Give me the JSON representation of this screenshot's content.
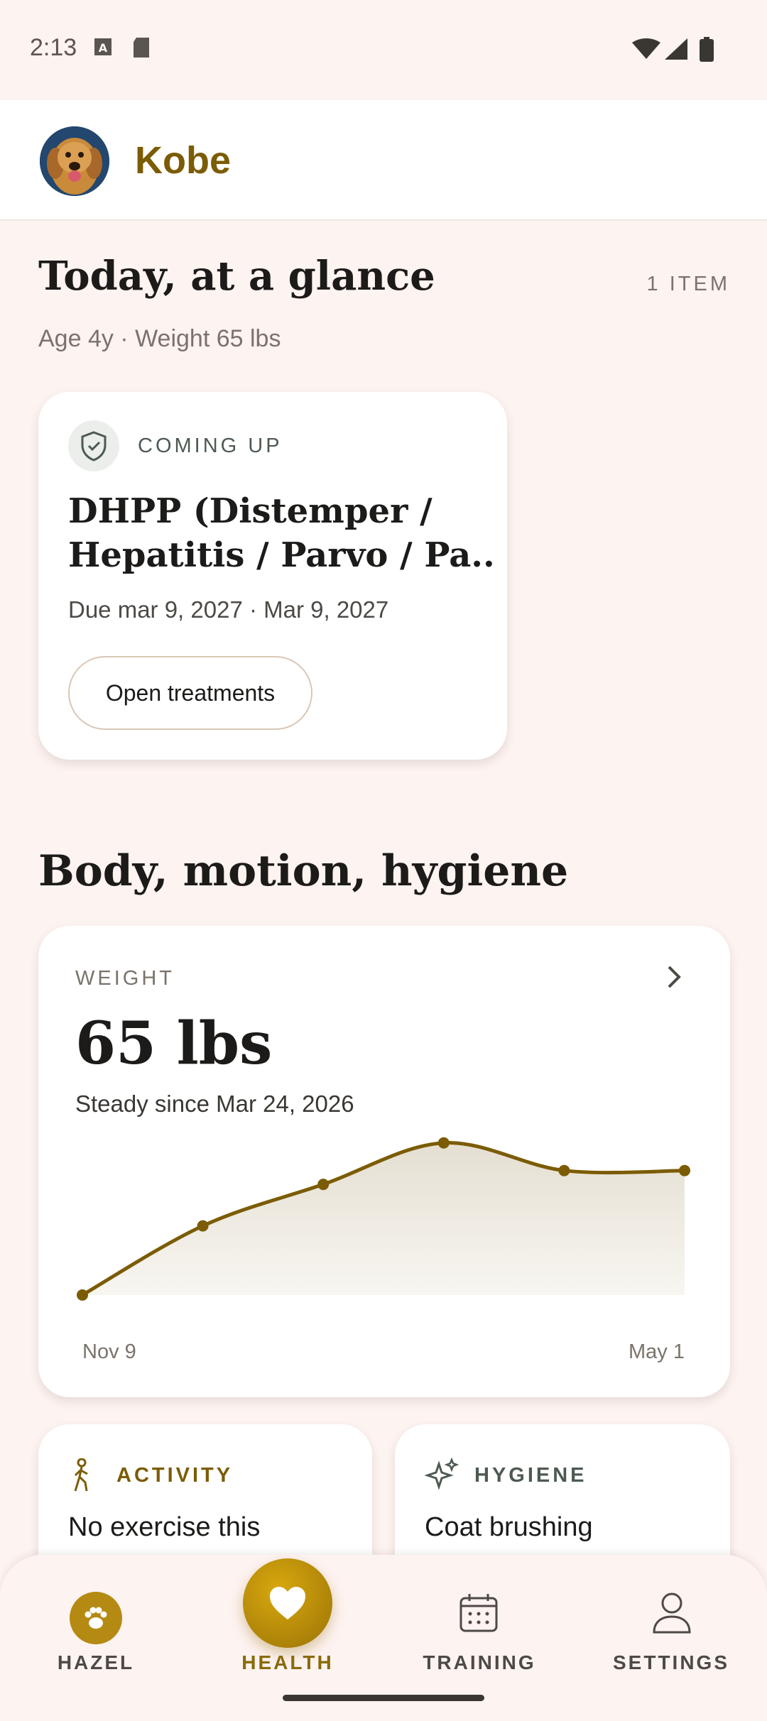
{
  "status_bar": {
    "time": "2:13"
  },
  "header": {
    "pet_name": "Kobe"
  },
  "today": {
    "title": "Today, at a glance",
    "item_count": "1 ITEM",
    "subtitle": "Age 4y · Weight 65 lbs",
    "card": {
      "eyebrow": "COMING UP",
      "title_line1": "DHPP (Distemper /",
      "title_line2": "Hepatitis / Parvo / Pa...",
      "due": "Due mar 9, 2027 · Mar 9, 2027",
      "button": "Open treatments"
    }
  },
  "body_section": {
    "title": "Body, motion, hygiene",
    "weight": {
      "eyebrow": "WEIGHT",
      "value": "65 lbs",
      "note": "Steady since Mar 24, 2026",
      "x_start": "Nov 9",
      "x_end": "May 1"
    },
    "activity": {
      "eyebrow": "ACTIVITY",
      "text": "No exercise this"
    },
    "hygiene": {
      "eyebrow": "HYGIENE",
      "text": "Coat brushing"
    }
  },
  "nav": {
    "items": [
      {
        "label": "HAZEL"
      },
      {
        "label": "HEALTH"
      },
      {
        "label": "TRAINING"
      },
      {
        "label": "SETTINGS"
      }
    ]
  },
  "colors": {
    "accent": "#7b5c04",
    "accent_gold": "#c99a08",
    "background": "#fdf3f1"
  },
  "chart_data": {
    "type": "area",
    "x": [
      "Nov 9",
      "",
      "",
      "",
      "",
      "May 1"
    ],
    "values": [
      0.0,
      0.5,
      0.8,
      1.1,
      0.9,
      0.9
    ],
    "xlabel": "",
    "ylabel": "",
    "grid": false
  }
}
